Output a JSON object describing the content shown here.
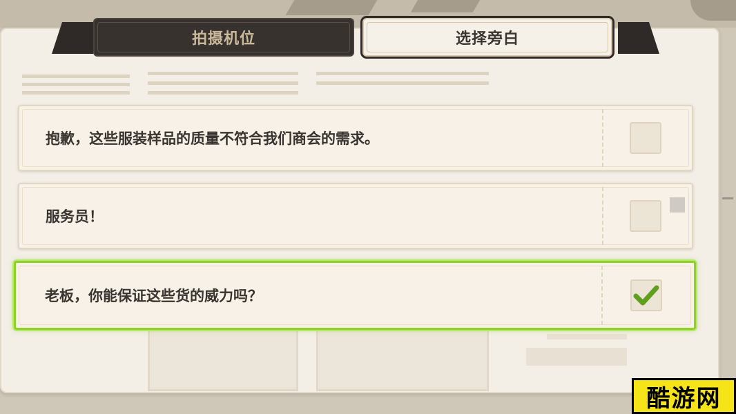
{
  "tabs": [
    {
      "label": "拍摄机位",
      "active": false
    },
    {
      "label": "选择旁白",
      "active": true
    }
  ],
  "options": [
    {
      "text": "抱歉，这些服装样品的质量不符合我们商会的需求。",
      "checked": false
    },
    {
      "text": "服务员！",
      "checked": false
    },
    {
      "text": "老板，你能保证这些货的威力吗？",
      "checked": true
    }
  ],
  "watermark": "酷游网",
  "colors": {
    "selected_border": "#8fd12b",
    "check_mark": "#5e9f1e",
    "tab_dark": "#38322e",
    "tab_light": "#f6f1e8",
    "panel": "#f3eee6"
  }
}
